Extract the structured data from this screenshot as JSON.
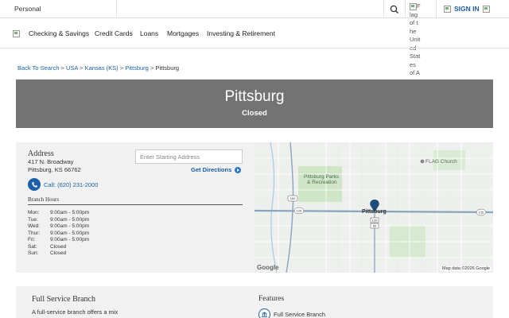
{
  "topbar": {
    "segment": "Personal",
    "flag_alt": "Flag of the United States of America",
    "sign_in": "SIGN IN"
  },
  "nav": {
    "items": [
      "Checking & Savings",
      "Credit Cards",
      "Loans",
      "Mortgages",
      "Investing & Retirement"
    ]
  },
  "breadcrumb": {
    "back": "Back To Search",
    "items": [
      "USA",
      "Kansas (KS)",
      "Pittsburg"
    ],
    "current": "Pittsburg",
    "separator": ">"
  },
  "hero": {
    "title": "Pittsburg",
    "status": "Closed"
  },
  "branch": {
    "address_heading": "Address",
    "street": "417 N. Broadway",
    "city_line": "Pittsburg, KS 66762",
    "start_placeholder": "Enter Starting Address",
    "get_directions": "Get Directions",
    "phone": "Call: (620) 231-2000",
    "hours_heading": "Branch Hours",
    "hours": [
      {
        "day": "Mon:",
        "time": "9:00am - 5:00pm"
      },
      {
        "day": "Tue:",
        "time": "9:00am - 5:00pm"
      },
      {
        "day": "Wed:",
        "time": "9:00am - 5:00pm"
      },
      {
        "day": "Thur:",
        "time": "9:00am - 5:00pm"
      },
      {
        "day": "Fri:",
        "time": "9:00am - 5:00pm"
      },
      {
        "day": "Sat:",
        "time": "Closed"
      },
      {
        "day": "Sun:",
        "time": "Closed"
      }
    ]
  },
  "map": {
    "town_label": "Pittsburg",
    "park_label_1": "Pittsburg Parks",
    "park_label_2": "& Recreation",
    "church_label": "FLAG Church",
    "shield_160": "160",
    "shield_126_left": "126",
    "shield_126_right": "126",
    "shield_126_mid": "126",
    "shield_69": "69",
    "google": "Google",
    "attribution": "Map data ©2026 Google",
    "colors": {
      "road": "#8aa3bd",
      "park": "#cfe6c6",
      "pin": "#1d4f7a",
      "water": "#a7c8e4"
    }
  },
  "service": {
    "title": "Full Service Branch",
    "desc": "A full-service branch offers a mix",
    "features_title": "Features",
    "feature_1": "Full Service Branch"
  },
  "colors": {
    "brand_blue": "#1a5fa8",
    "hero_bg": "#737373",
    "card_bg": "#f1f1f1"
  }
}
